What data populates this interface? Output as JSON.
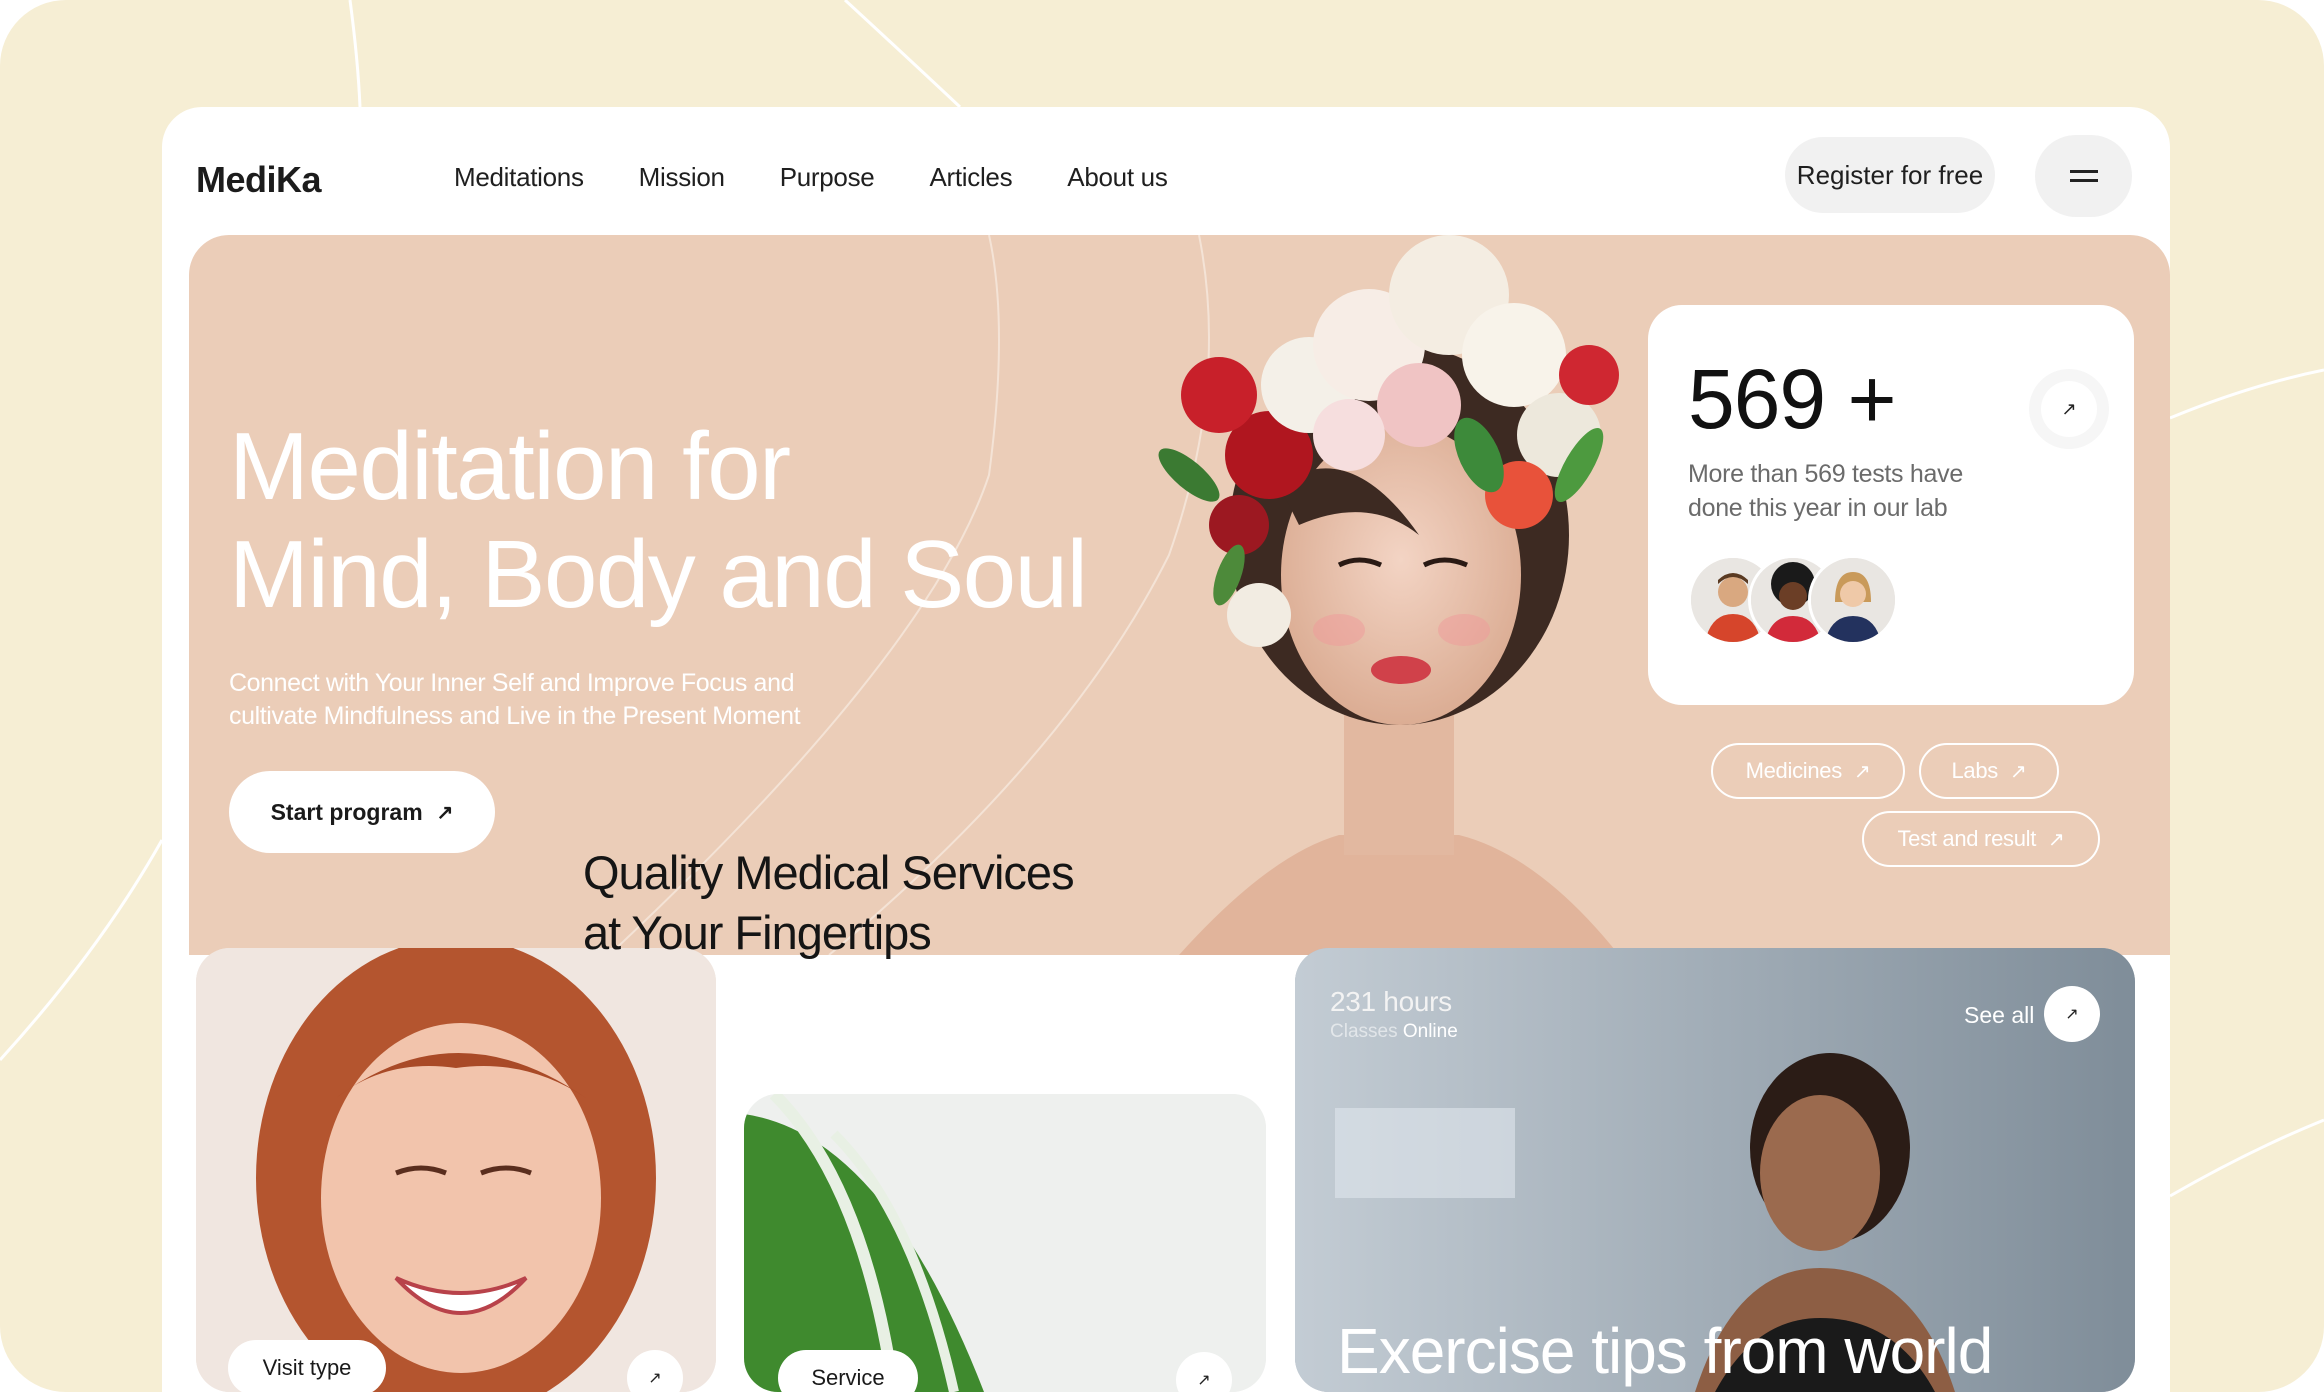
{
  "brand": {
    "logo": "MediKa"
  },
  "nav": {
    "items": [
      "Meditations",
      "Mission",
      "Purpose",
      "Articles",
      "About us"
    ]
  },
  "header": {
    "register_label": "Register for free"
  },
  "hero": {
    "title_line1": "Meditation for",
    "title_line2": "Mind, Body and Soul",
    "subtitle_line1": "Connect with Your Inner Self and Improve Focus and",
    "subtitle_line2": "cultivate Mindfulness and Live in the Present Moment",
    "cta_label": "Start program"
  },
  "stat": {
    "number": "569 +",
    "text_line1": "More than 569 tests have",
    "text_line2": "done this year in our lab"
  },
  "tags": [
    "Medicines",
    "Labs",
    "Test and result"
  ],
  "services": {
    "title_line1": "Quality Medical Services",
    "title_line2": "at Your Fingertips",
    "visit_label": "Visit type",
    "service_label": "Service"
  },
  "exercise": {
    "hours": "231 hours",
    "classes": "Classes",
    "online": "Online",
    "see_all": "See all",
    "title": "Exercise tips from world"
  },
  "icons": {
    "arrow": "arrow-up-right-icon",
    "menu": "hamburger-menu-icon"
  },
  "colors": {
    "background": "#f6eed4",
    "hero": "#ebcdb8",
    "card": "#ffffff",
    "text": "#1c1c1c"
  }
}
